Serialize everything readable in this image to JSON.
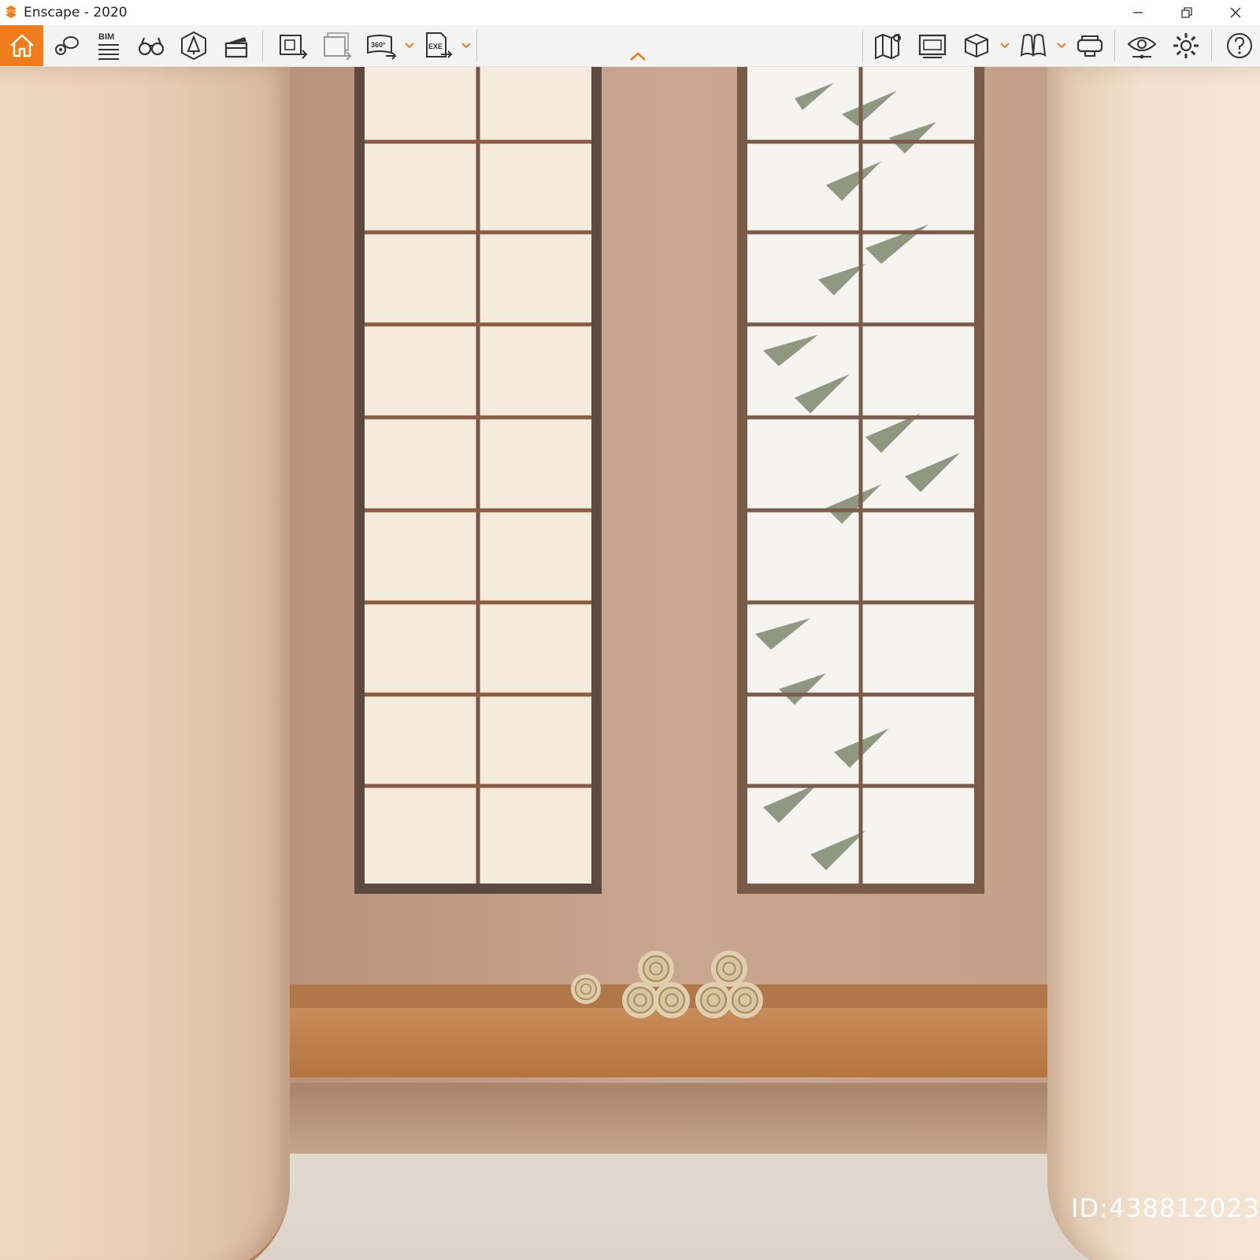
{
  "window": {
    "title": "Enscape - 2020",
    "controls": [
      "minimize",
      "restore",
      "close"
    ]
  },
  "toolbar": {
    "accent_color": "#f07d1d",
    "bim_label": "BIM",
    "vr_label": "360°",
    "exe_label": "EXE",
    "items": [
      {
        "icon": "home-icon",
        "active": true
      },
      {
        "icon": "views-icon"
      },
      {
        "icon": "bim-icon"
      },
      {
        "icon": "binoculars-icon"
      },
      {
        "icon": "asset-library-icon"
      },
      {
        "icon": "video-editor-icon"
      },
      {
        "icon": "screenshot-export-icon"
      },
      {
        "icon": "batch-render-icon"
      },
      {
        "icon": "panorama-360-icon"
      },
      {
        "icon": "exe-export-icon"
      },
      {
        "icon": "map-icon"
      },
      {
        "icon": "collaboration-icon"
      },
      {
        "icon": "material-editor-icon"
      },
      {
        "icon": "book-icon"
      },
      {
        "icon": "vr-headset-icon"
      },
      {
        "icon": "visual-settings-icon"
      },
      {
        "icon": "settings-icon"
      },
      {
        "icon": "help-icon"
      }
    ]
  },
  "viewport": {
    "scene": "rendered interior: two shoji paper windows, wooden bench with rolled bamboo mats",
    "watermark_id": "ID:438812023"
  }
}
